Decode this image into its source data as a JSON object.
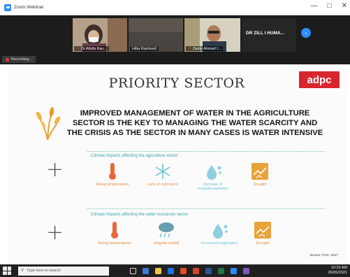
{
  "window": {
    "title": "Zoom Webinar",
    "controls": [
      "—",
      "□",
      "✕"
    ]
  },
  "participants": [
    {
      "name": "Dr.Abida Kau..."
    },
    {
      "name": "Hiba Rasheed"
    },
    {
      "name": "Zamir Ahmed I..."
    },
    {
      "name": "DR ZILL I HUMA..."
    }
  ],
  "next_icon": "chevron-right-icon",
  "recording": {
    "label": "Recording..."
  },
  "slide": {
    "title": "PRIORITY SECTOR",
    "logo": "adpc",
    "headline_line1": "IMPROVED MANAGEMENT OF WATER IN THE AGRICULTURE",
    "headline_line2": "SECTOR IS THE KEY TO MANAGING THE WATER SCARCITY AND",
    "headline_line3": "THE CRISIS AS THE SECTOR IN MANY CASES IS WATER INTENSIVE",
    "section1": {
      "heading": "Climate impacts affecting the agriculture sector",
      "items": [
        {
          "label": "Rising temperatures",
          "icon": "thermometer-icon"
        },
        {
          "label": "Lack of cold hours",
          "icon": "snowflake-icon"
        },
        {
          "label_line1": "Increase of",
          "label_line2": "evapotranspiration",
          "icon": "evaporation-icon"
        },
        {
          "label": "Drought",
          "icon": "drought-icon"
        }
      ]
    },
    "section2": {
      "heading": "Climate impacts affecting the water resources sector",
      "items": [
        {
          "label": "Rising temperatures",
          "icon": "thermometer-icon"
        },
        {
          "label": "Irregular rainfall",
          "icon": "rain-cloud-icon"
        },
        {
          "label": "Increased evaporation",
          "icon": "evaporation-icon"
        },
        {
          "label": "Drought",
          "icon": "drought-icon"
        }
      ]
    },
    "source": "Source: FAO, 2017"
  },
  "taskbar": {
    "search_placeholder": "Type here to search",
    "time": "10:20 AM",
    "date": "26/05/2021"
  },
  "colors": {
    "accent": "#2d8cff",
    "logo": "#d7262e",
    "teal": "#38a3a8",
    "orange": "#e88b3a"
  }
}
